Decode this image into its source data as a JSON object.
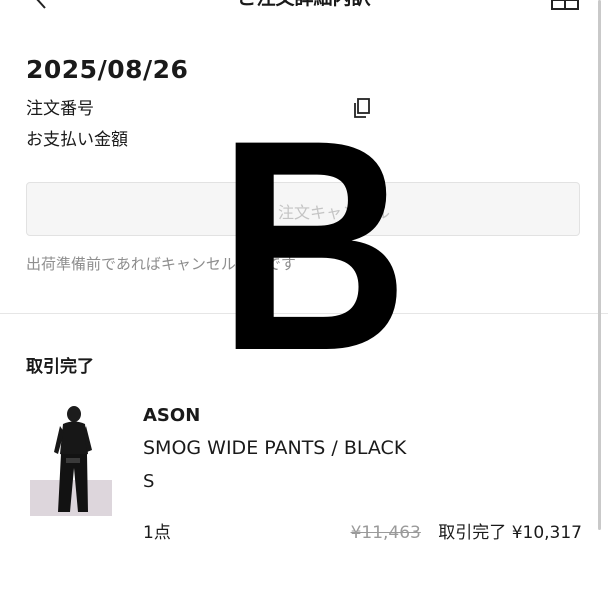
{
  "header": {
    "title": "ご注文詳細内訳",
    "back_icon": "chevron-left-icon",
    "menu_icon": "menu-grid-icon"
  },
  "order": {
    "date": "2025/08/26",
    "number_label": "注文番号",
    "copy_icon": "copy-icon",
    "payment_label": "お支払い金額",
    "cancel_button_label": "注文キャンセル",
    "cancel_note": "出荷準備前であればキャンセル可能です"
  },
  "item_section": {
    "status": "取引完了",
    "item": {
      "brand": "ASON",
      "name": "SMOG WIDE PANTS / BLACK",
      "size": "S",
      "quantity": "1点",
      "original_price": "¥11,463",
      "status_label": "取引完了",
      "price": "¥10,317"
    }
  },
  "overlay": {
    "letter": "B"
  }
}
